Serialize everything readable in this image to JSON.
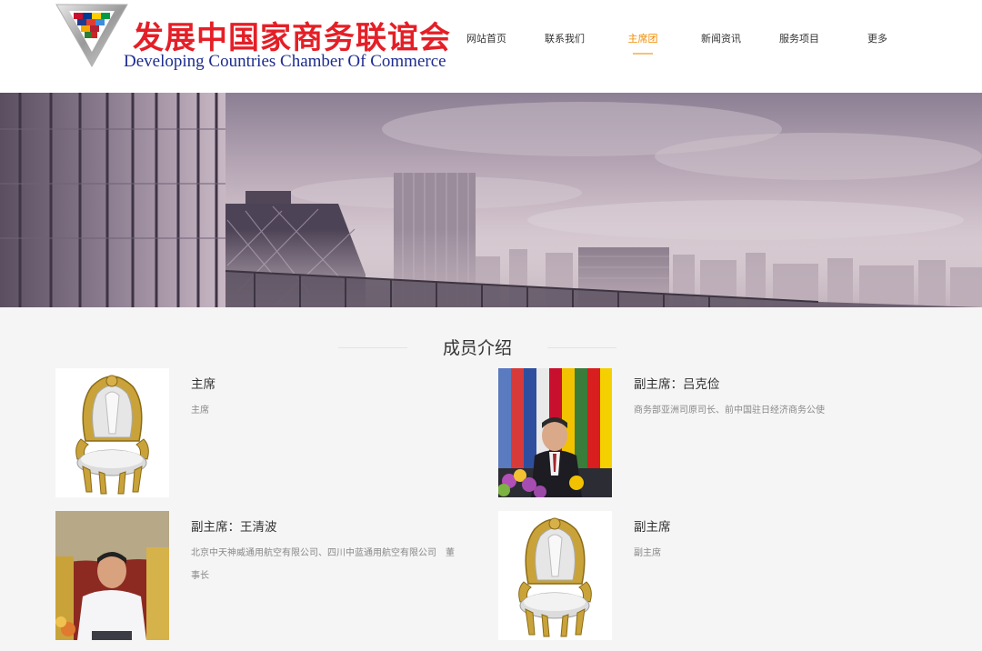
{
  "header": {
    "logo_cn": "发展中国家商务联谊会",
    "logo_en": "Developing Countries Chamber Of Commerce",
    "logo_icon": "triangle-flags-logo-icon"
  },
  "nav": {
    "items": [
      {
        "label": "网站首页",
        "active": false
      },
      {
        "label": "联系我们",
        "active": false
      },
      {
        "label": "主席团",
        "active": true
      },
      {
        "label": "新闻资讯",
        "active": false
      },
      {
        "label": "服务项目",
        "active": false
      },
      {
        "label": "更多",
        "active": false
      }
    ],
    "active_color": "#f08c00"
  },
  "banner": {
    "description_icon": "city-skyline-banner-image"
  },
  "members": {
    "section_title": "成员介绍",
    "list": [
      {
        "name": "主席",
        "desc": "主席",
        "photo": "throne-chair-image"
      },
      {
        "name": "副主席：吕克俭",
        "desc": "商务部亚洲司原司长、前中国驻日经济商务公使",
        "photo": "speaker-photo-image"
      },
      {
        "name": "副主席：王清波",
        "desc": "北京中天神威通用航空有限公司、四川中蓝通用航空有限公司　董事长",
        "photo": "speaker-photo-image"
      },
      {
        "name": "副主席",
        "desc": "副主席",
        "photo": "throne-chair-image"
      }
    ]
  }
}
